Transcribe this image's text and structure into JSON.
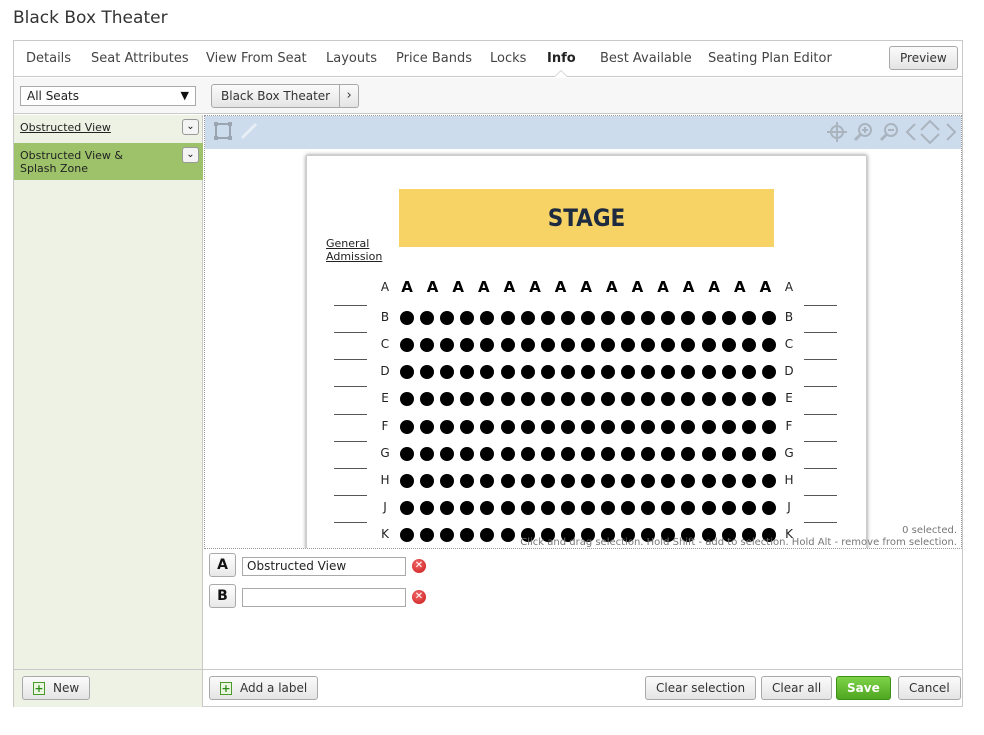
{
  "page": {
    "title": "Black Box Theater"
  },
  "tabs": [
    {
      "label": "Details"
    },
    {
      "label": "Seat Attributes"
    },
    {
      "label": "View From Seat"
    },
    {
      "label": "Layouts"
    },
    {
      "label": "Price Bands"
    },
    {
      "label": "Locks"
    },
    {
      "label": "Info",
      "active": true
    },
    {
      "label": "Best Available"
    },
    {
      "label": "Seating Plan Editor"
    }
  ],
  "preview_label": "Preview",
  "filter": {
    "selected": "All Seats"
  },
  "breadcrumb": {
    "label": "Black Box Theater"
  },
  "labels_list": [
    {
      "label": "Obstructed View",
      "selected": false
    },
    {
      "label": "Obstructed View & Splash Zone",
      "selected": true
    }
  ],
  "new_label": "New",
  "seat_plan": {
    "stage_label": "STAGE",
    "general_admission_label": "General Admission",
    "row_a_label": "A",
    "rows": [
      "B",
      "C",
      "D",
      "E",
      "F",
      "G",
      "H",
      "J",
      "K"
    ]
  },
  "selection_status": "0 selected.",
  "selection_hint": "Click and drag selection. Hold Shift - add to selection. Hold Alt - remove from selection.",
  "editor_labels": [
    {
      "letter": "A",
      "value": "Obstructed View"
    },
    {
      "letter": "B",
      "value": ""
    }
  ],
  "footer": {
    "add_label": "Add a label",
    "clear_selection": "Clear selection",
    "clear_all": "Clear all",
    "save": "Save",
    "cancel": "Cancel"
  },
  "colors": {
    "accent_green": "#9dc26a",
    "stage": "#f7d265",
    "save": "#5fb82c"
  }
}
